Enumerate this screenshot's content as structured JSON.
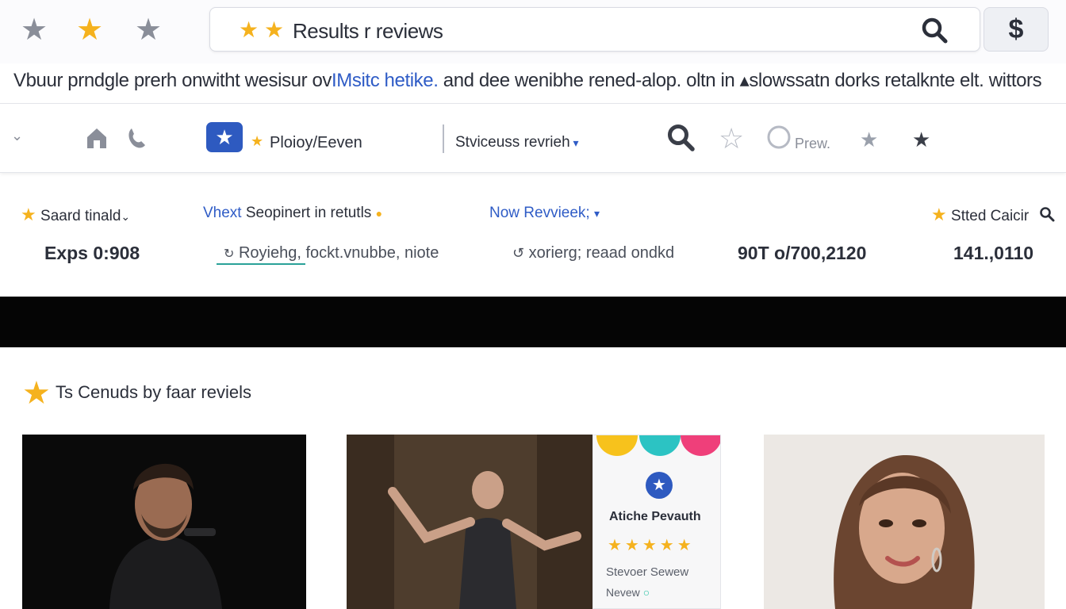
{
  "top_bar": {
    "rating_star_labels": [
      "gray-star",
      "gold-star",
      "gray-star"
    ],
    "search_text": "Results r reviews",
    "currency_button": "$"
  },
  "tagline": {
    "part1": "Vbuur pr",
    "part1b": "ndgle prerh onwitht wesisur ov",
    "highlight": "IMsitc hetike.",
    "part2": " and dee wenibhe rened-alop. olt",
    "part3": "n in ",
    "part4": "slowssatn dorks retalknte elt. wittors"
  },
  "toolbar": {
    "brand_label": "Ploioy/Eeven",
    "dropdown_label": "Stviceuss revrieh",
    "preview_label": "Prew."
  },
  "stats": {
    "col1": {
      "label": "Saard tinald",
      "value": "Exps 0:908"
    },
    "col2": {
      "label_blue": "Vhext",
      "label_rest": " Seopinert in retutls",
      "sub": "Royiehg, fockt.vnubbe, niote"
    },
    "col3": {
      "label": "Now Revvieek;",
      "sub": "xorierg; reaad ondkd"
    },
    "col4": {
      "value": "90T o/700,2120"
    },
    "col5": {
      "label": "Stted Caicir",
      "value": "141.,0110"
    }
  },
  "section": {
    "title": "Ts Cenuds by faar reviels"
  },
  "cards": {
    "review_card": {
      "title": "Atiche Pevauth",
      "stars": "★★★★★",
      "subtitle": "Stevoer Sewew",
      "subtitle2": "Nevew"
    }
  },
  "colors": {
    "accent_blue": "#2f5cc6",
    "star_gold": "#f5b21e",
    "star_gray": "#8a8e99",
    "dot_yellow": "#f7c21c",
    "dot_teal": "#2cc3c3",
    "dot_pink": "#ef3f7a"
  }
}
